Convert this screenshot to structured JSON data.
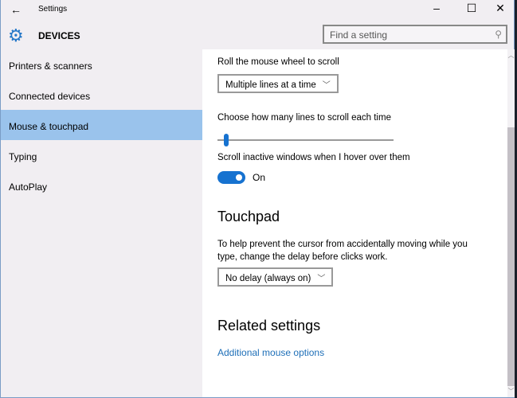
{
  "window": {
    "title": "Settings",
    "back": "←",
    "minimize": "–",
    "maximize": "☐",
    "close": "✕"
  },
  "header": {
    "section": "DEVICES",
    "search_placeholder": "Find a setting"
  },
  "sidebar": {
    "items": [
      {
        "label": "Printers & scanners"
      },
      {
        "label": "Connected devices"
      },
      {
        "label": "Mouse & touchpad",
        "selected": true
      },
      {
        "label": "Typing"
      },
      {
        "label": "AutoPlay"
      }
    ]
  },
  "main": {
    "wheel_label": "Roll the mouse wheel to scroll",
    "wheel_value": "Multiple lines at a time",
    "lines_label": "Choose how many lines to scroll each time",
    "lines_slider_fraction": 0.02,
    "inactive_label": "Scroll inactive windows when I hover over them",
    "inactive_state": "On",
    "touchpad_heading": "Touchpad",
    "touchpad_desc": "To help prevent the cursor from accidentally moving while you type, change the delay before clicks work.",
    "touchpad_value": "No delay (always on)",
    "related_heading": "Related settings",
    "related_link": "Additional mouse options"
  },
  "colors": {
    "accent": "#1672d0",
    "selected": "#9ac3ec",
    "link": "#1e6fb8"
  }
}
